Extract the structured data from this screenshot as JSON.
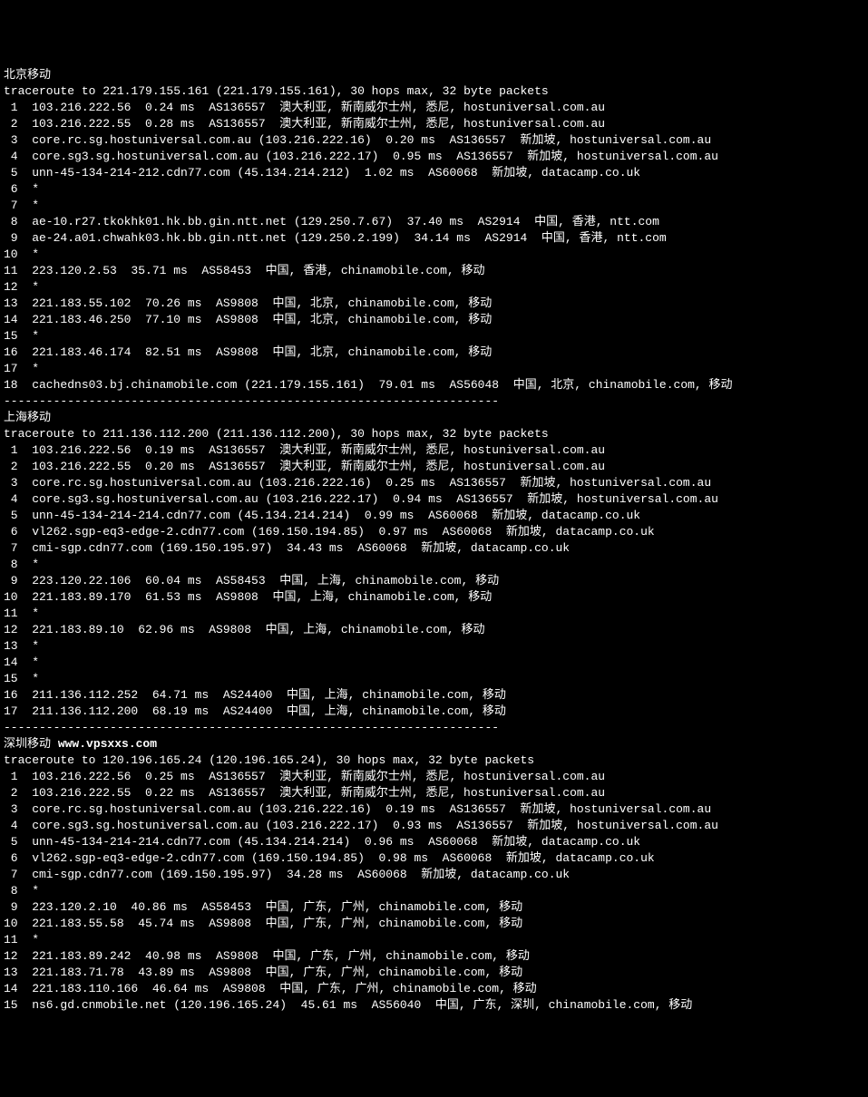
{
  "sections": [
    {
      "title": "北京移动",
      "header": "traceroute to 221.179.155.161 (221.179.155.161), 30 hops max, 32 byte packets",
      "hops": [
        " 1  103.216.222.56  0.24 ms  AS136557  澳大利亚, 新南威尔士州, 悉尼, hostuniversal.com.au",
        " 2  103.216.222.55  0.28 ms  AS136557  澳大利亚, 新南威尔士州, 悉尼, hostuniversal.com.au",
        " 3  core.rc.sg.hostuniversal.com.au (103.216.222.16)  0.20 ms  AS136557  新加坡, hostuniversal.com.au",
        " 4  core.sg3.sg.hostuniversal.com.au (103.216.222.17)  0.95 ms  AS136557  新加坡, hostuniversal.com.au",
        " 5  unn-45-134-214-212.cdn77.com (45.134.214.212)  1.02 ms  AS60068  新加坡, datacamp.co.uk",
        " 6  *",
        " 7  *",
        " 8  ae-10.r27.tkokhk01.hk.bb.gin.ntt.net (129.250.7.67)  37.40 ms  AS2914  中国, 香港, ntt.com",
        " 9  ae-24.a01.chwahk03.hk.bb.gin.ntt.net (129.250.2.199)  34.14 ms  AS2914  中国, 香港, ntt.com",
        "10  *",
        "11  223.120.2.53  35.71 ms  AS58453  中国, 香港, chinamobile.com, 移动",
        "12  *",
        "13  221.183.55.102  70.26 ms  AS9808  中国, 北京, chinamobile.com, 移动",
        "14  221.183.46.250  77.10 ms  AS9808  中国, 北京, chinamobile.com, 移动",
        "15  *",
        "16  221.183.46.174  82.51 ms  AS9808  中国, 北京, chinamobile.com, 移动",
        "17  *",
        "18  cachedns03.bj.chinamobile.com (221.179.155.161)  79.01 ms  AS56048  中国, 北京, chinamobile.com, 移动"
      ]
    },
    {
      "title": "上海移动",
      "header": "traceroute to 211.136.112.200 (211.136.112.200), 30 hops max, 32 byte packets",
      "hops": [
        " 1  103.216.222.56  0.19 ms  AS136557  澳大利亚, 新南威尔士州, 悉尼, hostuniversal.com.au",
        " 2  103.216.222.55  0.20 ms  AS136557  澳大利亚, 新南威尔士州, 悉尼, hostuniversal.com.au",
        " 3  core.rc.sg.hostuniversal.com.au (103.216.222.16)  0.25 ms  AS136557  新加坡, hostuniversal.com.au",
        " 4  core.sg3.sg.hostuniversal.com.au (103.216.222.17)  0.94 ms  AS136557  新加坡, hostuniversal.com.au",
        " 5  unn-45-134-214-214.cdn77.com (45.134.214.214)  0.99 ms  AS60068  新加坡, datacamp.co.uk",
        " 6  vl262.sgp-eq3-edge-2.cdn77.com (169.150.194.85)  0.97 ms  AS60068  新加坡, datacamp.co.uk",
        " 7  cmi-sgp.cdn77.com (169.150.195.97)  34.43 ms  AS60068  新加坡, datacamp.co.uk",
        " 8  *",
        " 9  223.120.22.106  60.04 ms  AS58453  中国, 上海, chinamobile.com, 移动",
        "10  221.183.89.170  61.53 ms  AS9808  中国, 上海, chinamobile.com, 移动",
        "11  *",
        "12  221.183.89.10  62.96 ms  AS9808  中国, 上海, chinamobile.com, 移动",
        "13  *",
        "14  *",
        "15  *",
        "16  211.136.112.252  64.71 ms  AS24400  中国, 上海, chinamobile.com, 移动",
        "17  211.136.112.200  68.19 ms  AS24400  中国, 上海, chinamobile.com, 移动"
      ]
    },
    {
      "title": "深圳移动 ",
      "title_bold": "www.vpsxxs.com",
      "header": "traceroute to 120.196.165.24 (120.196.165.24), 30 hops max, 32 byte packets",
      "hops": [
        " 1  103.216.222.56  0.25 ms  AS136557  澳大利亚, 新南威尔士州, 悉尼, hostuniversal.com.au",
        " 2  103.216.222.55  0.22 ms  AS136557  澳大利亚, 新南威尔士州, 悉尼, hostuniversal.com.au",
        " 3  core.rc.sg.hostuniversal.com.au (103.216.222.16)  0.19 ms  AS136557  新加坡, hostuniversal.com.au",
        " 4  core.sg3.sg.hostuniversal.com.au (103.216.222.17)  0.93 ms  AS136557  新加坡, hostuniversal.com.au",
        " 5  unn-45-134-214-214.cdn77.com (45.134.214.214)  0.96 ms  AS60068  新加坡, datacamp.co.uk",
        " 6  vl262.sgp-eq3-edge-2.cdn77.com (169.150.194.85)  0.98 ms  AS60068  新加坡, datacamp.co.uk",
        " 7  cmi-sgp.cdn77.com (169.150.195.97)  34.28 ms  AS60068  新加坡, datacamp.co.uk",
        " 8  *",
        " 9  223.120.2.10  40.86 ms  AS58453  中国, 广东, 广州, chinamobile.com, 移动",
        "10  221.183.55.58  45.74 ms  AS9808  中国, 广东, 广州, chinamobile.com, 移动",
        "11  *",
        "12  221.183.89.242  40.98 ms  AS9808  中国, 广东, 广州, chinamobile.com, 移动",
        "13  221.183.71.78  43.89 ms  AS9808  中国, 广东, 广州, chinamobile.com, 移动",
        "14  221.183.110.166  46.64 ms  AS9808  中国, 广东, 广州, chinamobile.com, 移动",
        "15  ns6.gd.cnmobile.net (120.196.165.24)  45.61 ms  AS56040  中国, 广东, 深圳, chinamobile.com, 移动"
      ]
    }
  ],
  "divider": "----------------------------------------------------------------------"
}
